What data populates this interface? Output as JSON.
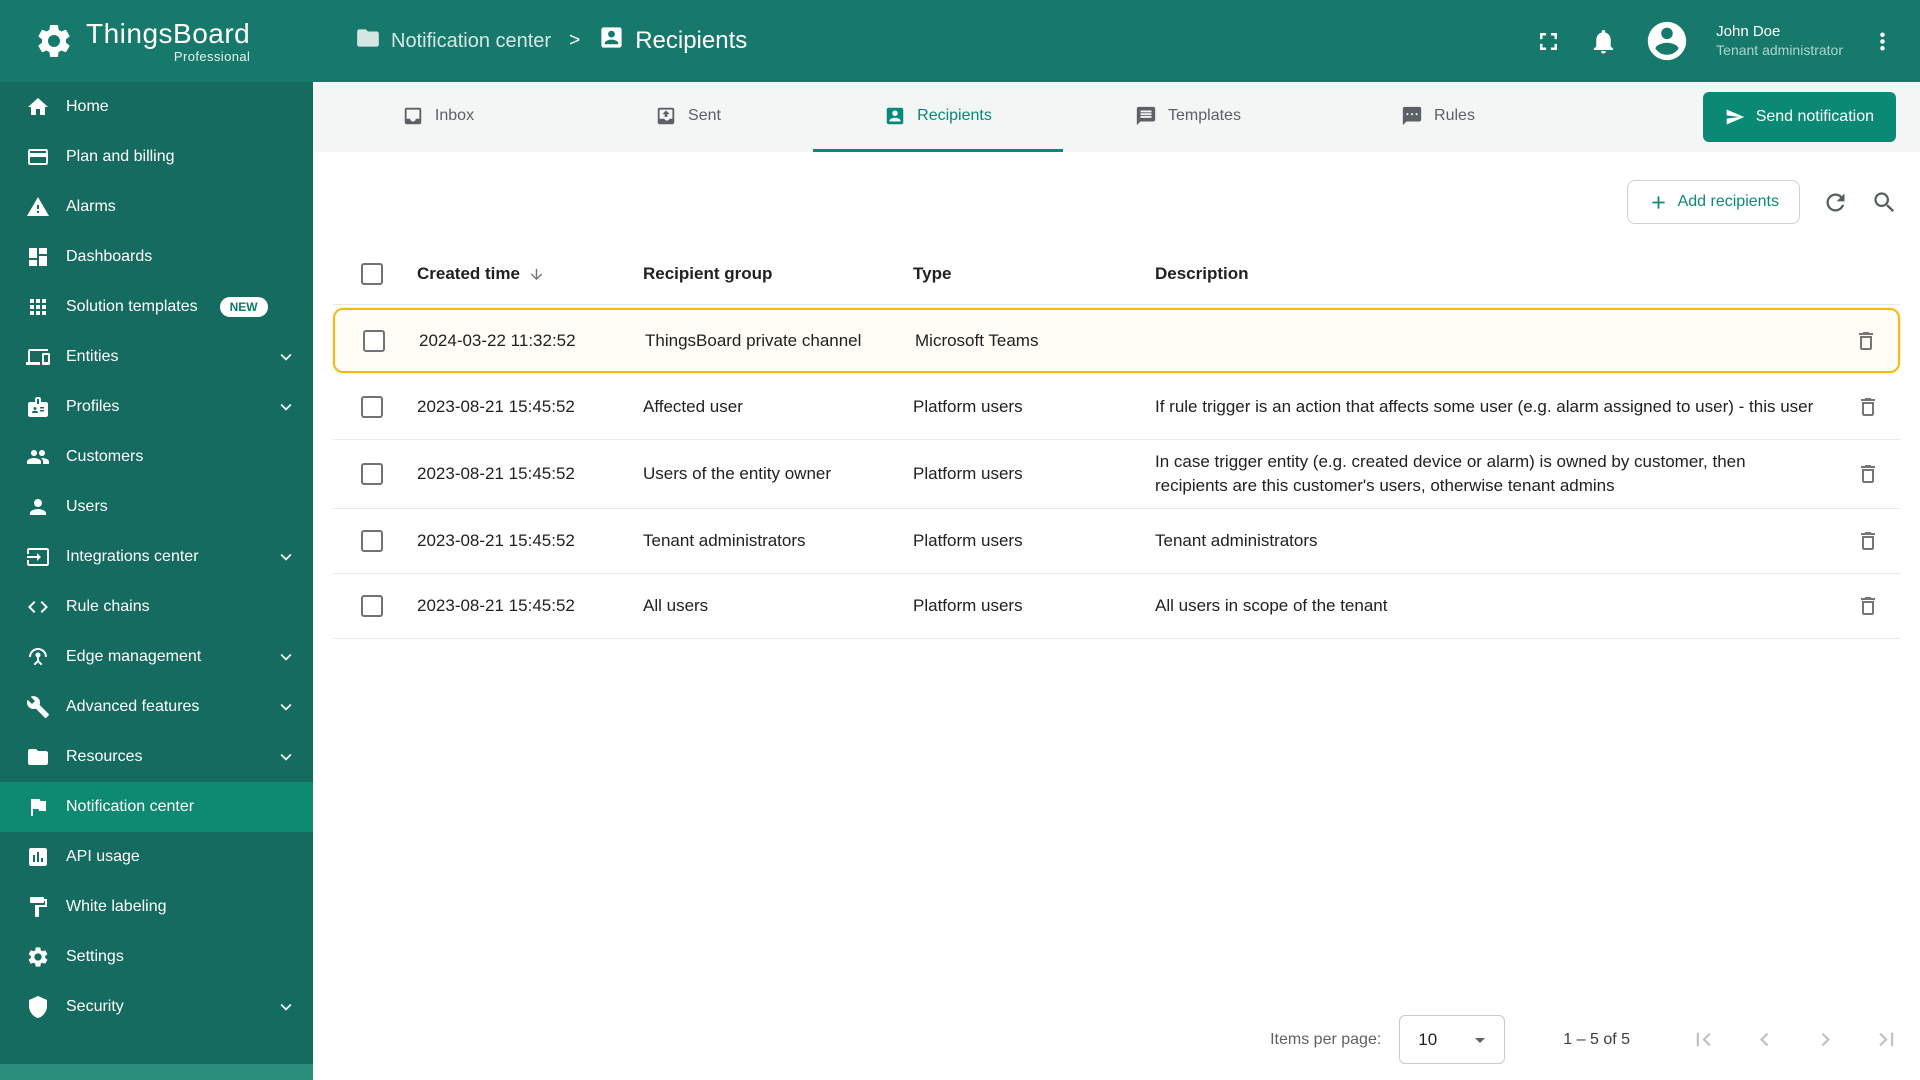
{
  "colors": {
    "header": "#17796B",
    "sidebar": "#156B5F",
    "sidebar_active": "#0E8A72",
    "accent": "#0A8A74",
    "tab_active": "#07897A",
    "highlight_border": "#F5B914",
    "tabbar_bg": "#F4F5F5"
  },
  "app": {
    "logo_title": "ThingsBoard",
    "logo_subtitle": "Professional"
  },
  "header": {
    "breadcrumb": {
      "parent": "Notification center",
      "separator": ">",
      "current": "Recipients"
    },
    "user": {
      "name": "John Doe",
      "role": "Tenant administrator"
    }
  },
  "sidebar": {
    "items": [
      {
        "label": "Home",
        "icon": "home"
      },
      {
        "label": "Plan and billing",
        "icon": "credit-card"
      },
      {
        "label": "Alarms",
        "icon": "warning"
      },
      {
        "label": "Dashboards",
        "icon": "dashboard"
      },
      {
        "label": "Solution templates",
        "icon": "apps",
        "badge": "NEW"
      },
      {
        "label": "Entities",
        "icon": "devices",
        "expandable": true
      },
      {
        "label": "Profiles",
        "icon": "badge",
        "expandable": true
      },
      {
        "label": "Customers",
        "icon": "people"
      },
      {
        "label": "Users",
        "icon": "person"
      },
      {
        "label": "Integrations center",
        "icon": "input",
        "expandable": true
      },
      {
        "label": "Rule chains",
        "icon": "code"
      },
      {
        "label": "Edge management",
        "icon": "router",
        "expandable": true
      },
      {
        "label": "Advanced features",
        "icon": "build",
        "expandable": true
      },
      {
        "label": "Resources",
        "icon": "folder",
        "expandable": true
      },
      {
        "label": "Notification center",
        "icon": "flag",
        "active": true
      },
      {
        "label": "API usage",
        "icon": "chart"
      },
      {
        "label": "White labeling",
        "icon": "paint"
      },
      {
        "label": "Settings",
        "icon": "gear"
      },
      {
        "label": "Security",
        "icon": "shield",
        "expandable": true
      }
    ]
  },
  "tabs": [
    {
      "label": "Inbox",
      "icon": "inbox"
    },
    {
      "label": "Sent",
      "icon": "outbox"
    },
    {
      "label": "Recipients",
      "icon": "account-box",
      "active": true
    },
    {
      "label": "Templates",
      "icon": "templates"
    },
    {
      "label": "Rules",
      "icon": "rules"
    }
  ],
  "actions": {
    "send_notification": "Send notification",
    "add_recipients": "Add recipients"
  },
  "table": {
    "columns": [
      "Created time",
      "Recipient group",
      "Type",
      "Description"
    ],
    "rows": [
      {
        "created": "2024-03-22 11:32:52",
        "group": "ThingsBoard private channel",
        "type": "Microsoft Teams",
        "description": "",
        "highlighted": true
      },
      {
        "created": "2023-08-21 15:45:52",
        "group": "Affected user",
        "type": "Platform users",
        "description": "If rule trigger is an action that affects some user (e.g. alarm assigned to user) - this user"
      },
      {
        "created": "2023-08-21 15:45:52",
        "group": "Users of the entity owner",
        "type": "Platform users",
        "description": "In case trigger entity (e.g. created device or alarm) is owned by customer, then recipients are this customer's users, otherwise tenant admins"
      },
      {
        "created": "2023-08-21 15:45:52",
        "group": "Tenant administrators",
        "type": "Platform users",
        "description": "Tenant administrators"
      },
      {
        "created": "2023-08-21 15:45:52",
        "group": "All users",
        "type": "Platform users",
        "description": "All users in scope of the tenant"
      }
    ]
  },
  "pagination": {
    "items_per_page_label": "Items per page:",
    "items_per_page_value": "10",
    "range": "1 – 5 of 5"
  }
}
